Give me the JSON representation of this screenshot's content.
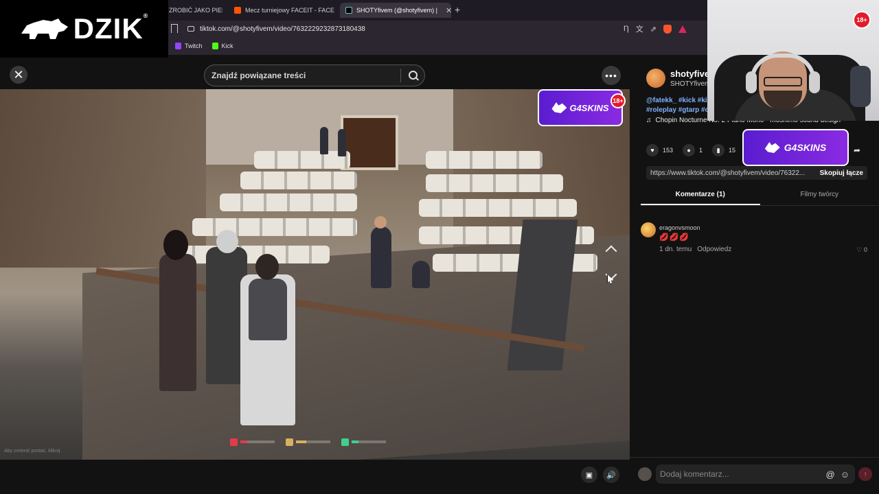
{
  "browser": {
    "tabs": [
      {
        "title": "ZROBIĆ JAKO PIERW",
        "favicon_color": "#e84a3c"
      },
      {
        "title": "Mecz turniejowy FACEIT - FACEIT.com",
        "favicon_color": "#ff5500"
      },
      {
        "title": "SHOTYfivem (@shotyfivem) |",
        "favicon_color": "#000000",
        "active": true
      }
    ],
    "new_tab": "+",
    "url": "tiktok.com/@shotyfivem/video/7632229232873180438",
    "bookmarks": [
      {
        "label": "Twitch",
        "color": "#9146ff"
      },
      {
        "label": "Kick",
        "color": "#53fc18"
      }
    ]
  },
  "logo": {
    "text": "DZIK",
    "mark": "®"
  },
  "video": {
    "search_placeholder": "Znajdź powiązane treści",
    "close_symbol": "✕",
    "more_symbol": "•••",
    "sponsor": "G4SKINS",
    "age_badge": "18+",
    "hud_hint": "Aby zmienić postać, kliknij"
  },
  "panel": {
    "username": "shotyfivem",
    "nickname": "SHOTYfivem",
    "tags": "@fatekk_ #kick #kic #roleplay #gtarp #c",
    "music": "Chopin Nocturne No. 2 Piano Mono - moshimo sound design",
    "likes": "153",
    "comments_count": "1",
    "saves": "15",
    "share_link": "https://www.tiktok.com/@shotyfivem/video/76322...",
    "copy_link": "Skopiuj łącze",
    "tab_comments": "Komentarze (1)",
    "tab_creator": "Filmy twórcy",
    "comment": {
      "user": "eragonvsmoon",
      "text": "💋💋💋",
      "time": "1 dn. temu",
      "reply": "Odpowiedz",
      "likes": "0"
    },
    "add_comment_placeholder": "Dodaj komentarz..."
  },
  "overlay": {
    "sponsor": "G4SKINS",
    "age_badge": "18+"
  }
}
